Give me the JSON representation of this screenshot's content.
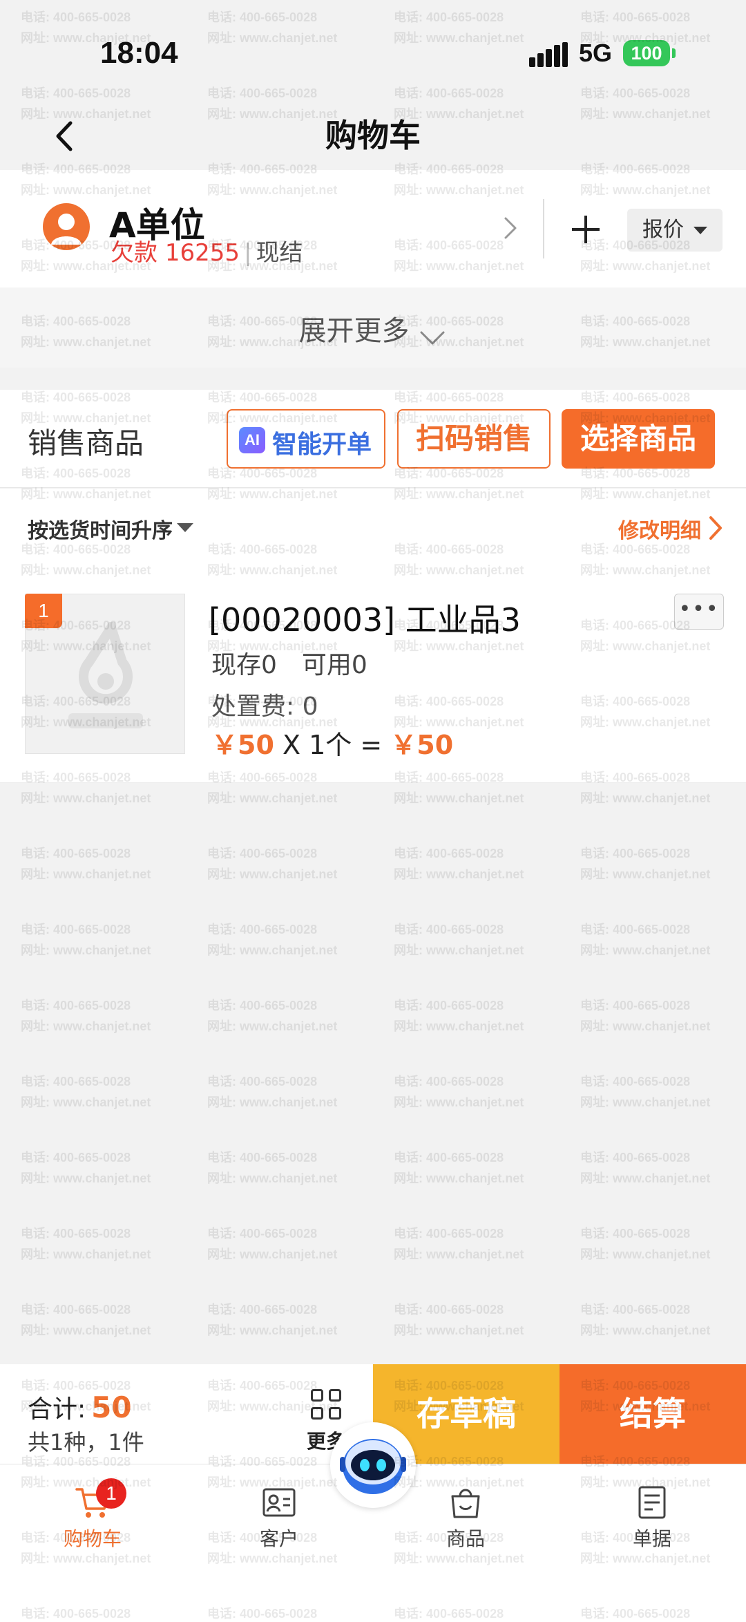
{
  "status_bar": {
    "time": "18:04",
    "network": "5G",
    "battery": "100"
  },
  "navbar": {
    "title": "购物车"
  },
  "customer": {
    "name": "A单位",
    "debt_label": "欠款",
    "debt_amount": "16255",
    "settlement": "现结",
    "quote_label": "报价"
  },
  "expand": {
    "label": "展开更多"
  },
  "sales": {
    "title": "销售商品",
    "ai_badge": "AI",
    "ai_label": "智能开单",
    "scan_label": "扫码销售",
    "select_label": "选择商品"
  },
  "sort": {
    "label": "按选货时间升序",
    "edit_label": "修改明细"
  },
  "product": {
    "index": "1",
    "name": "[00020003] 工业品3",
    "stock": "现存0　可用0",
    "fee": "处置费:  0",
    "unit_price": "￥50",
    "quantity_expr": " X 1个 = ",
    "subtotal": "￥50",
    "more": "•••"
  },
  "summary": {
    "total_label": "合计:",
    "total_value": "50",
    "count_text": "共1种，1件",
    "more_label": "更多",
    "draft_label": "存草稿",
    "settle_label": "结算"
  },
  "tabbar": {
    "items": [
      {
        "label": "购物车",
        "icon": "cart-icon",
        "badge": "1",
        "active": true
      },
      {
        "label": "客户",
        "icon": "contact-card-icon"
      },
      {
        "label": "商品",
        "icon": "bag-icon"
      },
      {
        "label": "单据",
        "icon": "document-icon"
      }
    ]
  },
  "watermark": {
    "line1": "电话: 400-665-0028",
    "line2": "网址: www.chanjet.net"
  },
  "colors": {
    "accent": "#f56c2a",
    "draft": "#f5b52c",
    "debt": "#e8403a",
    "ai": "#3b6fe0"
  }
}
